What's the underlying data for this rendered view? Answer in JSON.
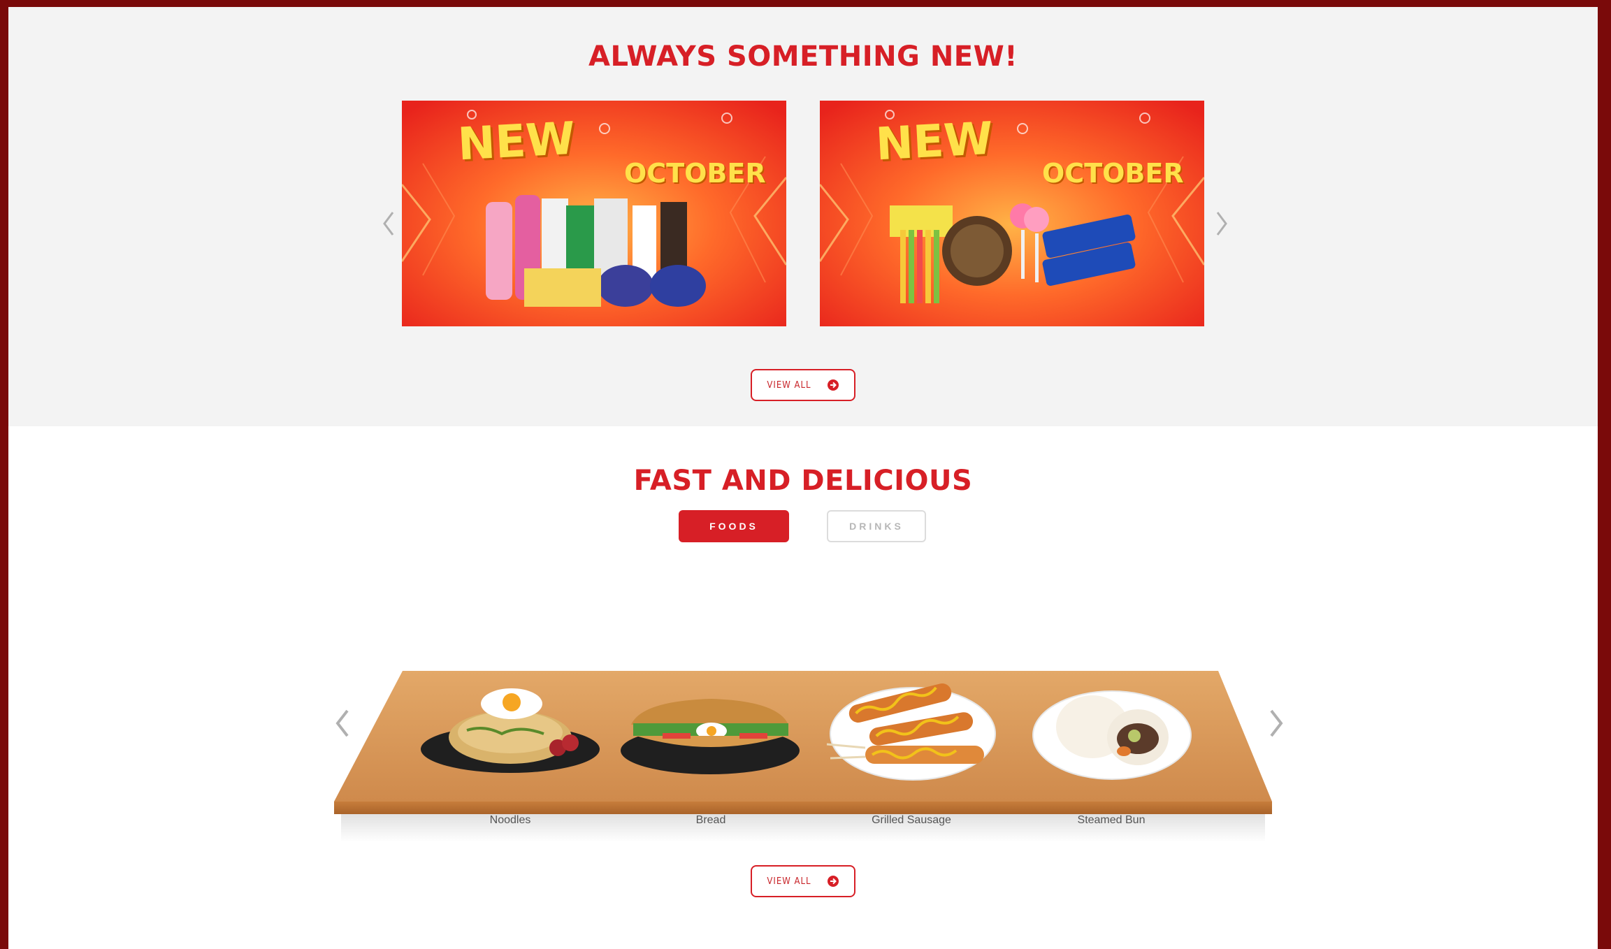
{
  "colors": {
    "accent": "#d71f26",
    "frame": "#7a0a0a",
    "section_bg": "#f3f3f3",
    "shelf": "#d6924f"
  },
  "new_section": {
    "title": "ALWAYS SOMETHING NEW!",
    "prev_icon": "chevron-left-icon",
    "next_icon": "chevron-right-icon",
    "promos": [
      {
        "headline": "NEW",
        "subhead": "OCTOBER"
      },
      {
        "headline": "NEW",
        "subhead": "OCTOBER"
      }
    ],
    "view_all_label": "VIEW ALL",
    "view_all_icon": "arrow-circle-right-icon"
  },
  "food_section": {
    "title": "FAST AND DELICIOUS",
    "tabs": [
      {
        "label": "FOODS",
        "active": true
      },
      {
        "label": "DRINKS",
        "active": false
      }
    ],
    "items": [
      {
        "label": "Noodles"
      },
      {
        "label": "Bread"
      },
      {
        "label": "Grilled Sausage"
      },
      {
        "label": "Steamed Bun"
      }
    ],
    "view_all_label": "VIEW ALL",
    "view_all_icon": "arrow-circle-right-icon"
  }
}
